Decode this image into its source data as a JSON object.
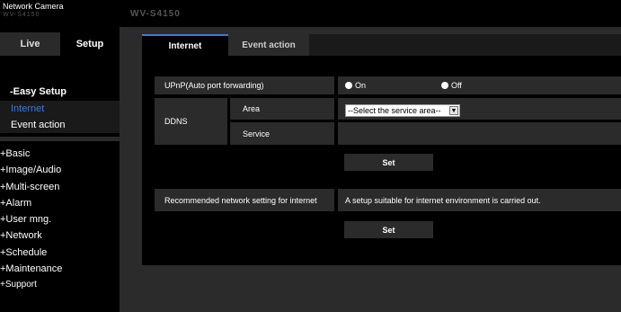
{
  "header": {
    "brand": "Network Camera",
    "brand_sub": "WV-S4150",
    "model": "WV-S4150"
  },
  "nav": {
    "live": "Live",
    "setup": "Setup"
  },
  "easy_setup": {
    "heading": "-Easy Setup",
    "items": [
      {
        "label": "Internet"
      },
      {
        "label": "Event action"
      }
    ]
  },
  "menu": {
    "items": [
      {
        "label": "+Basic"
      },
      {
        "label": "+Image/Audio"
      },
      {
        "label": "+Multi-screen"
      },
      {
        "label": "+Alarm"
      },
      {
        "label": "+User mng."
      },
      {
        "label": "+Network"
      },
      {
        "label": "+Schedule"
      },
      {
        "label": "+Maintenance"
      },
      {
        "label": "+Support"
      }
    ]
  },
  "tabs": [
    {
      "label": "Internet"
    },
    {
      "label": "Event action"
    }
  ],
  "form": {
    "upnp_label": "UPnP(Auto port forwarding)",
    "upnp_on": "On",
    "upnp_off": "Off",
    "upnp_selected": "On",
    "ddns_label": "DDNS",
    "area_label": "Area",
    "area_value": "--Select the service area--",
    "service_label": "Service",
    "set_label": "Set",
    "recommended_label": "Recommended network setting for internet",
    "recommended_desc": "A setup suitable for internet environment is carried out.",
    "set2_label": "Set"
  },
  "colors": {
    "accent": "#3c7ad8",
    "background": "#2b2b2b",
    "panel": "#000000"
  }
}
